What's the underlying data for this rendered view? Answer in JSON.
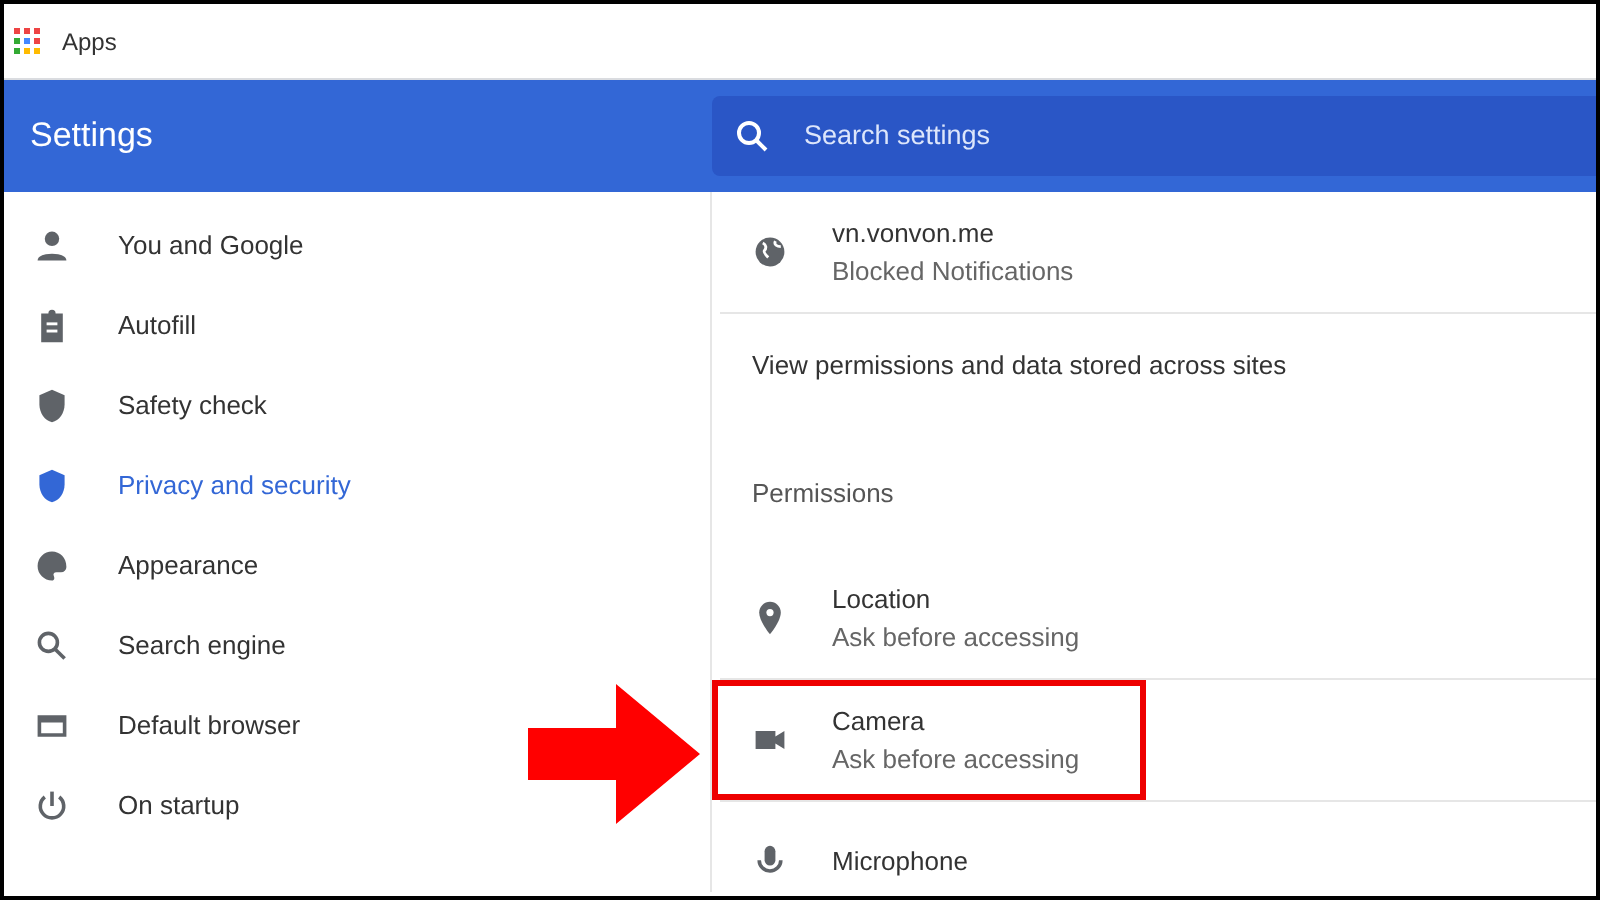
{
  "bookmarks_bar": {
    "apps_label": "Apps"
  },
  "header": {
    "title": "Settings",
    "search": {
      "placeholder": "Search settings"
    }
  },
  "sidebar": {
    "items": [
      {
        "label": "You and Google",
        "kind": "person",
        "selected": false
      },
      {
        "label": "Autofill",
        "kind": "clipboard",
        "selected": false
      },
      {
        "label": "Safety check",
        "kind": "shield",
        "selected": false
      },
      {
        "label": "Privacy and security",
        "kind": "shield",
        "selected": true
      },
      {
        "label": "Appearance",
        "kind": "palette",
        "selected": false
      },
      {
        "label": "Search engine",
        "kind": "search",
        "selected": false
      },
      {
        "label": "Default browser",
        "kind": "browser",
        "selected": false
      },
      {
        "label": "On startup",
        "kind": "power",
        "selected": false
      }
    ]
  },
  "content": {
    "recent_site": {
      "name": "vn.vonvon.me",
      "status": "Blocked Notifications"
    },
    "view_permissions_link": "View permissions and data stored across sites",
    "permissions_heading": "Permissions",
    "permissions": [
      {
        "name": "Location",
        "status": "Ask before accessing",
        "kind": "location",
        "highlighted": false
      },
      {
        "name": "Camera",
        "status": "Ask before accessing",
        "kind": "camera",
        "highlighted": true
      },
      {
        "name": "Microphone",
        "kind": "microphone",
        "highlighted": false
      }
    ]
  }
}
